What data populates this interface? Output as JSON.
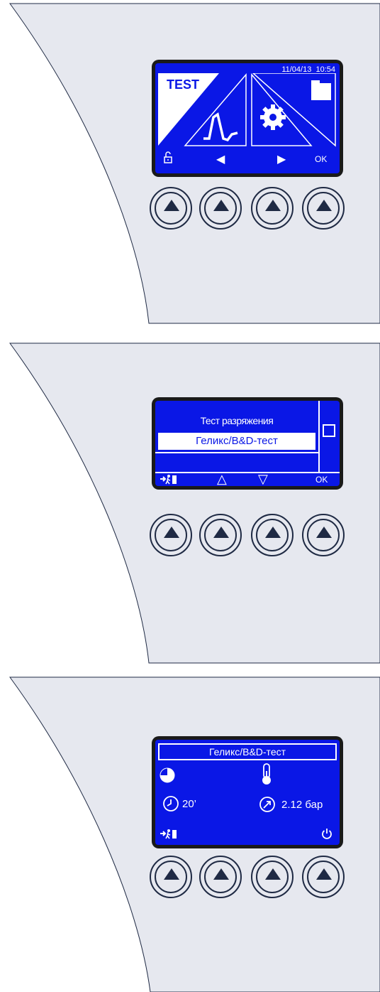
{
  "screen1": {
    "date": "11/04/13",
    "time": "10:54",
    "test_label": "TEST",
    "softkeys": {
      "left_icon": "unlock-icon",
      "prev": "◀",
      "next": "▶",
      "ok": "OK"
    }
  },
  "screen2": {
    "items": [
      "Тест разряжения",
      "Геликс/B&D-тест",
      ""
    ],
    "selected_index": 1,
    "softkeys": {
      "left_icon": "exit-icon",
      "up": "△",
      "down": "▽",
      "ok": "OK"
    }
  },
  "screen3": {
    "title": "Геликс/B&D-тест",
    "time_value": "20’",
    "pressure_value": "2.12 бар",
    "progress_fraction": 0.75,
    "softkeys": {
      "left_icon": "exit-icon",
      "right_icon": "power-icon"
    }
  },
  "colors": {
    "screen_bg": "#0a17e6",
    "panel_bg": "#e6e8ef",
    "bezel": "#1a1a1a",
    "button_ink": "#1f2a44"
  }
}
